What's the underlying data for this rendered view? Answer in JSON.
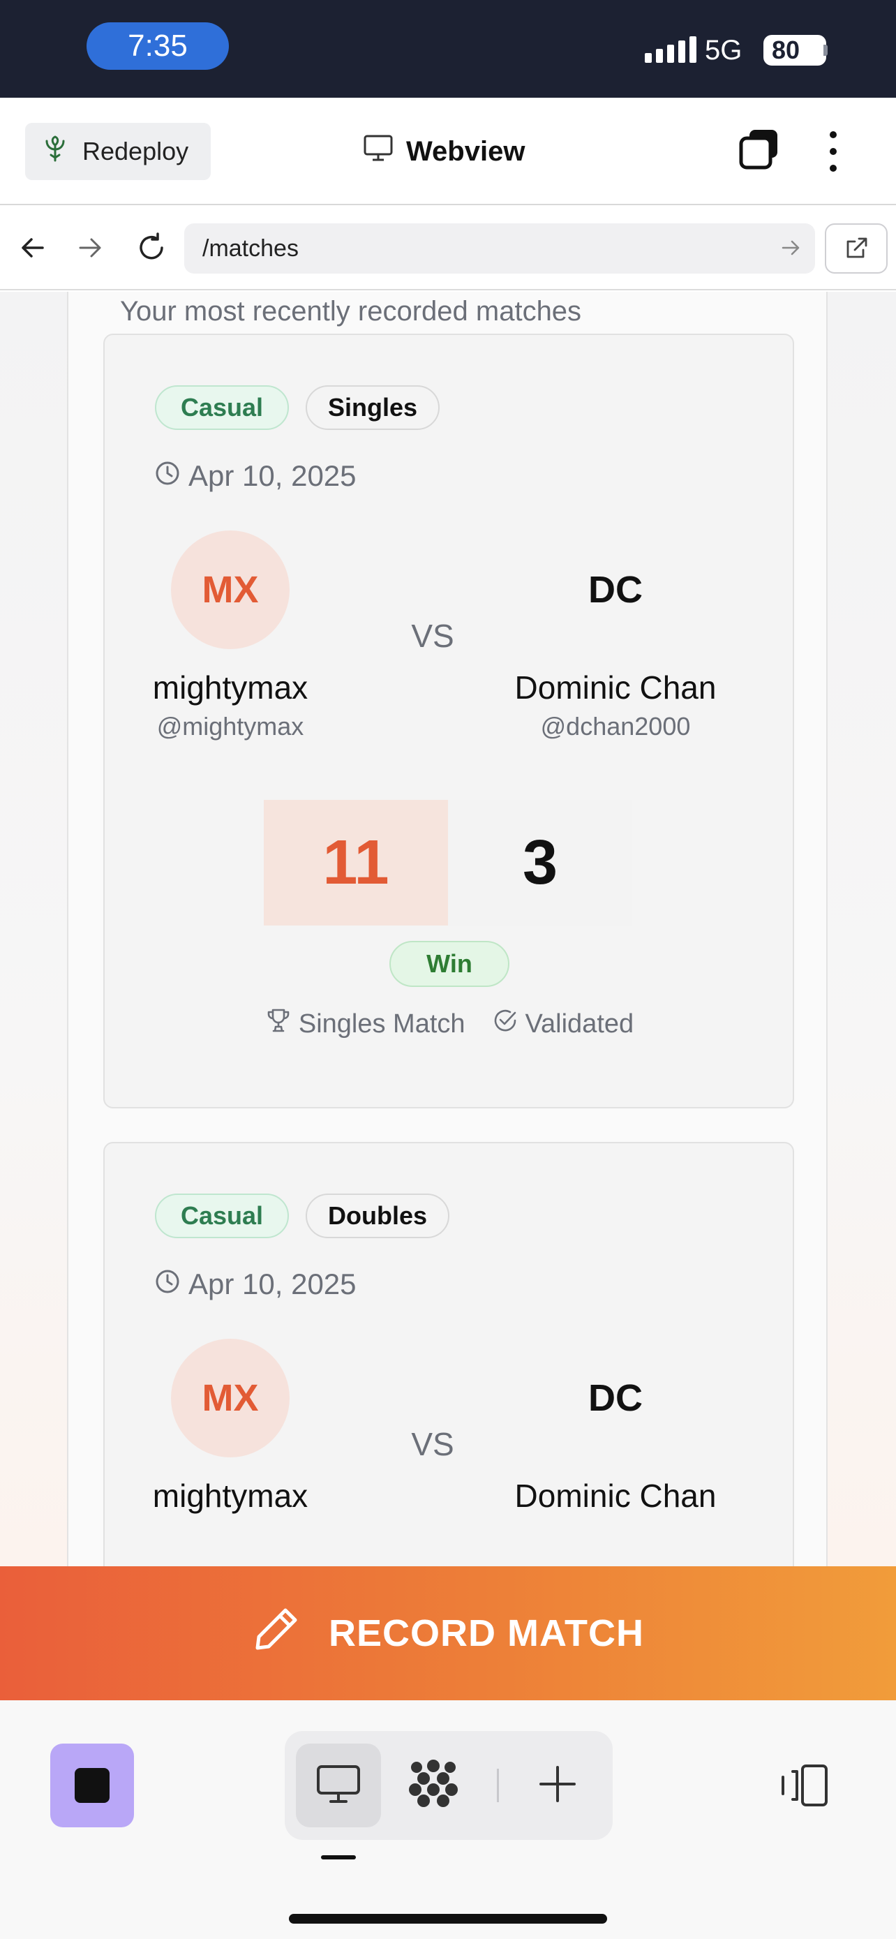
{
  "status": {
    "time": "7:35",
    "network": "5G",
    "battery": "80"
  },
  "header": {
    "redeploy_label": "Redeploy",
    "title": "Webview"
  },
  "urlbar": {
    "url": "/matches"
  },
  "page": {
    "subtitle": "Your most recently recorded matches",
    "matches": [
      {
        "mode": "Casual",
        "type": "Singles",
        "date": "Apr 10, 2025",
        "player1": {
          "initials": "MX",
          "name": "mightymax",
          "handle": "@mightymax"
        },
        "player2": {
          "initials": "DC",
          "name": "Dominic Chan",
          "handle": "@dchan2000"
        },
        "vs": "VS",
        "score1": "11",
        "score2": "3",
        "result": "Win",
        "meta_type": "Singles Match",
        "meta_status": "Validated"
      },
      {
        "mode": "Casual",
        "type": "Doubles",
        "date": "Apr 10, 2025",
        "player1": {
          "initials": "MX",
          "name": "mightymax"
        },
        "player2": {
          "initials": "DC",
          "name": "Dominic Chan"
        },
        "vs": "VS"
      }
    ]
  },
  "record_button": {
    "label": "RECORD MATCH"
  },
  "colors": {
    "accent": "#ea5f3a",
    "win_green": "#2e7d33",
    "casual_green": "#2e7d51"
  },
  "icons": [
    "redeploy-icon",
    "monitor-icon",
    "tabs-icon",
    "kebab-icon",
    "back-icon",
    "forward-icon",
    "reload-icon",
    "go-icon",
    "external-link-icon",
    "clock-icon",
    "trophy-icon",
    "check-circle-icon",
    "pencil-icon",
    "stop-icon",
    "desktop-icon",
    "apps-icon",
    "plus-icon",
    "layout-icon"
  ]
}
